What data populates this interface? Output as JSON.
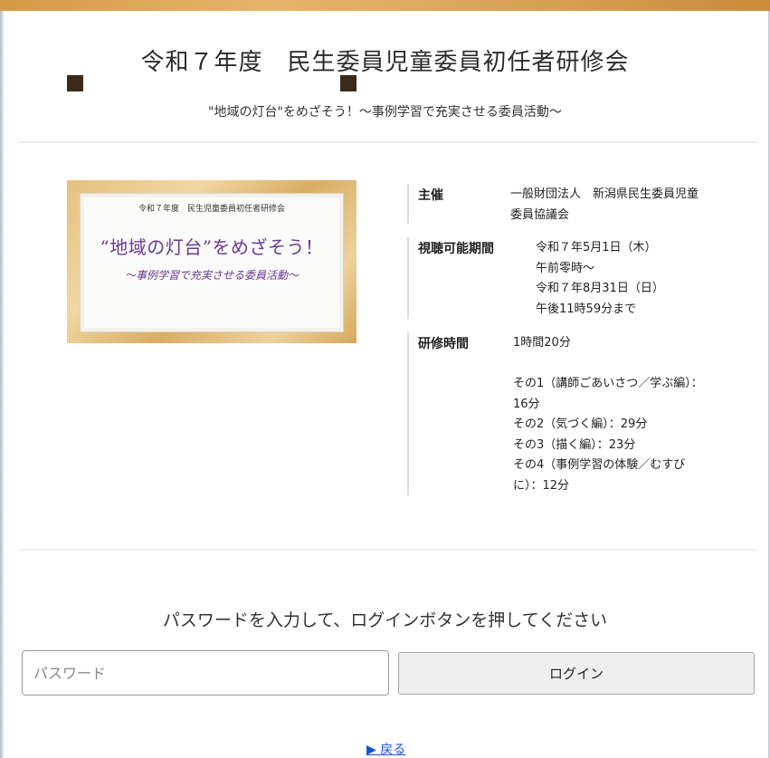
{
  "header": {
    "title": "令和７年度　民生委員児童委員初任者研修会",
    "subtitle": "\"地域の灯台\"をめざそう！～事例学習で充実させる委員活動～"
  },
  "banner": {
    "small_text": "令和７年度　民生児童委員初任者研修会",
    "main_text": "“地域の灯台”をめざそう！",
    "sub_text": "～事例学習で充実させる委員活動～"
  },
  "info": {
    "organizer": {
      "label": "主催",
      "lines": [
        "一般財団法人　新潟県民生委員児童",
        "委員協議会"
      ]
    },
    "period": {
      "label": "視聴可能期間",
      "lines": [
        "令和７年5月1日（木）",
        "午前零時～",
        "令和７年8月31日（日）",
        "午後11時59分まで"
      ]
    },
    "duration": {
      "label": "研修時間",
      "total": "1時間20分",
      "parts": [
        "その1（講師ごあいさつ／学ぶ編）：16分",
        "その2（気づく編）：29分",
        "その3（描く編）：23分",
        "その4（事例学習の体験／むすび に）：12分"
      ]
    }
  },
  "login": {
    "prompt": "パスワードを入力して、ログインボタンを押してください",
    "password_placeholder": "パスワード",
    "password_value": "",
    "button_label": "ログイン"
  },
  "footer": {
    "back_link": "▶ 戻る"
  },
  "colors": {
    "top_bar": "#d49a45",
    "banner_purple": "#6a3a92",
    "link_blue": "#1a4fd8"
  }
}
